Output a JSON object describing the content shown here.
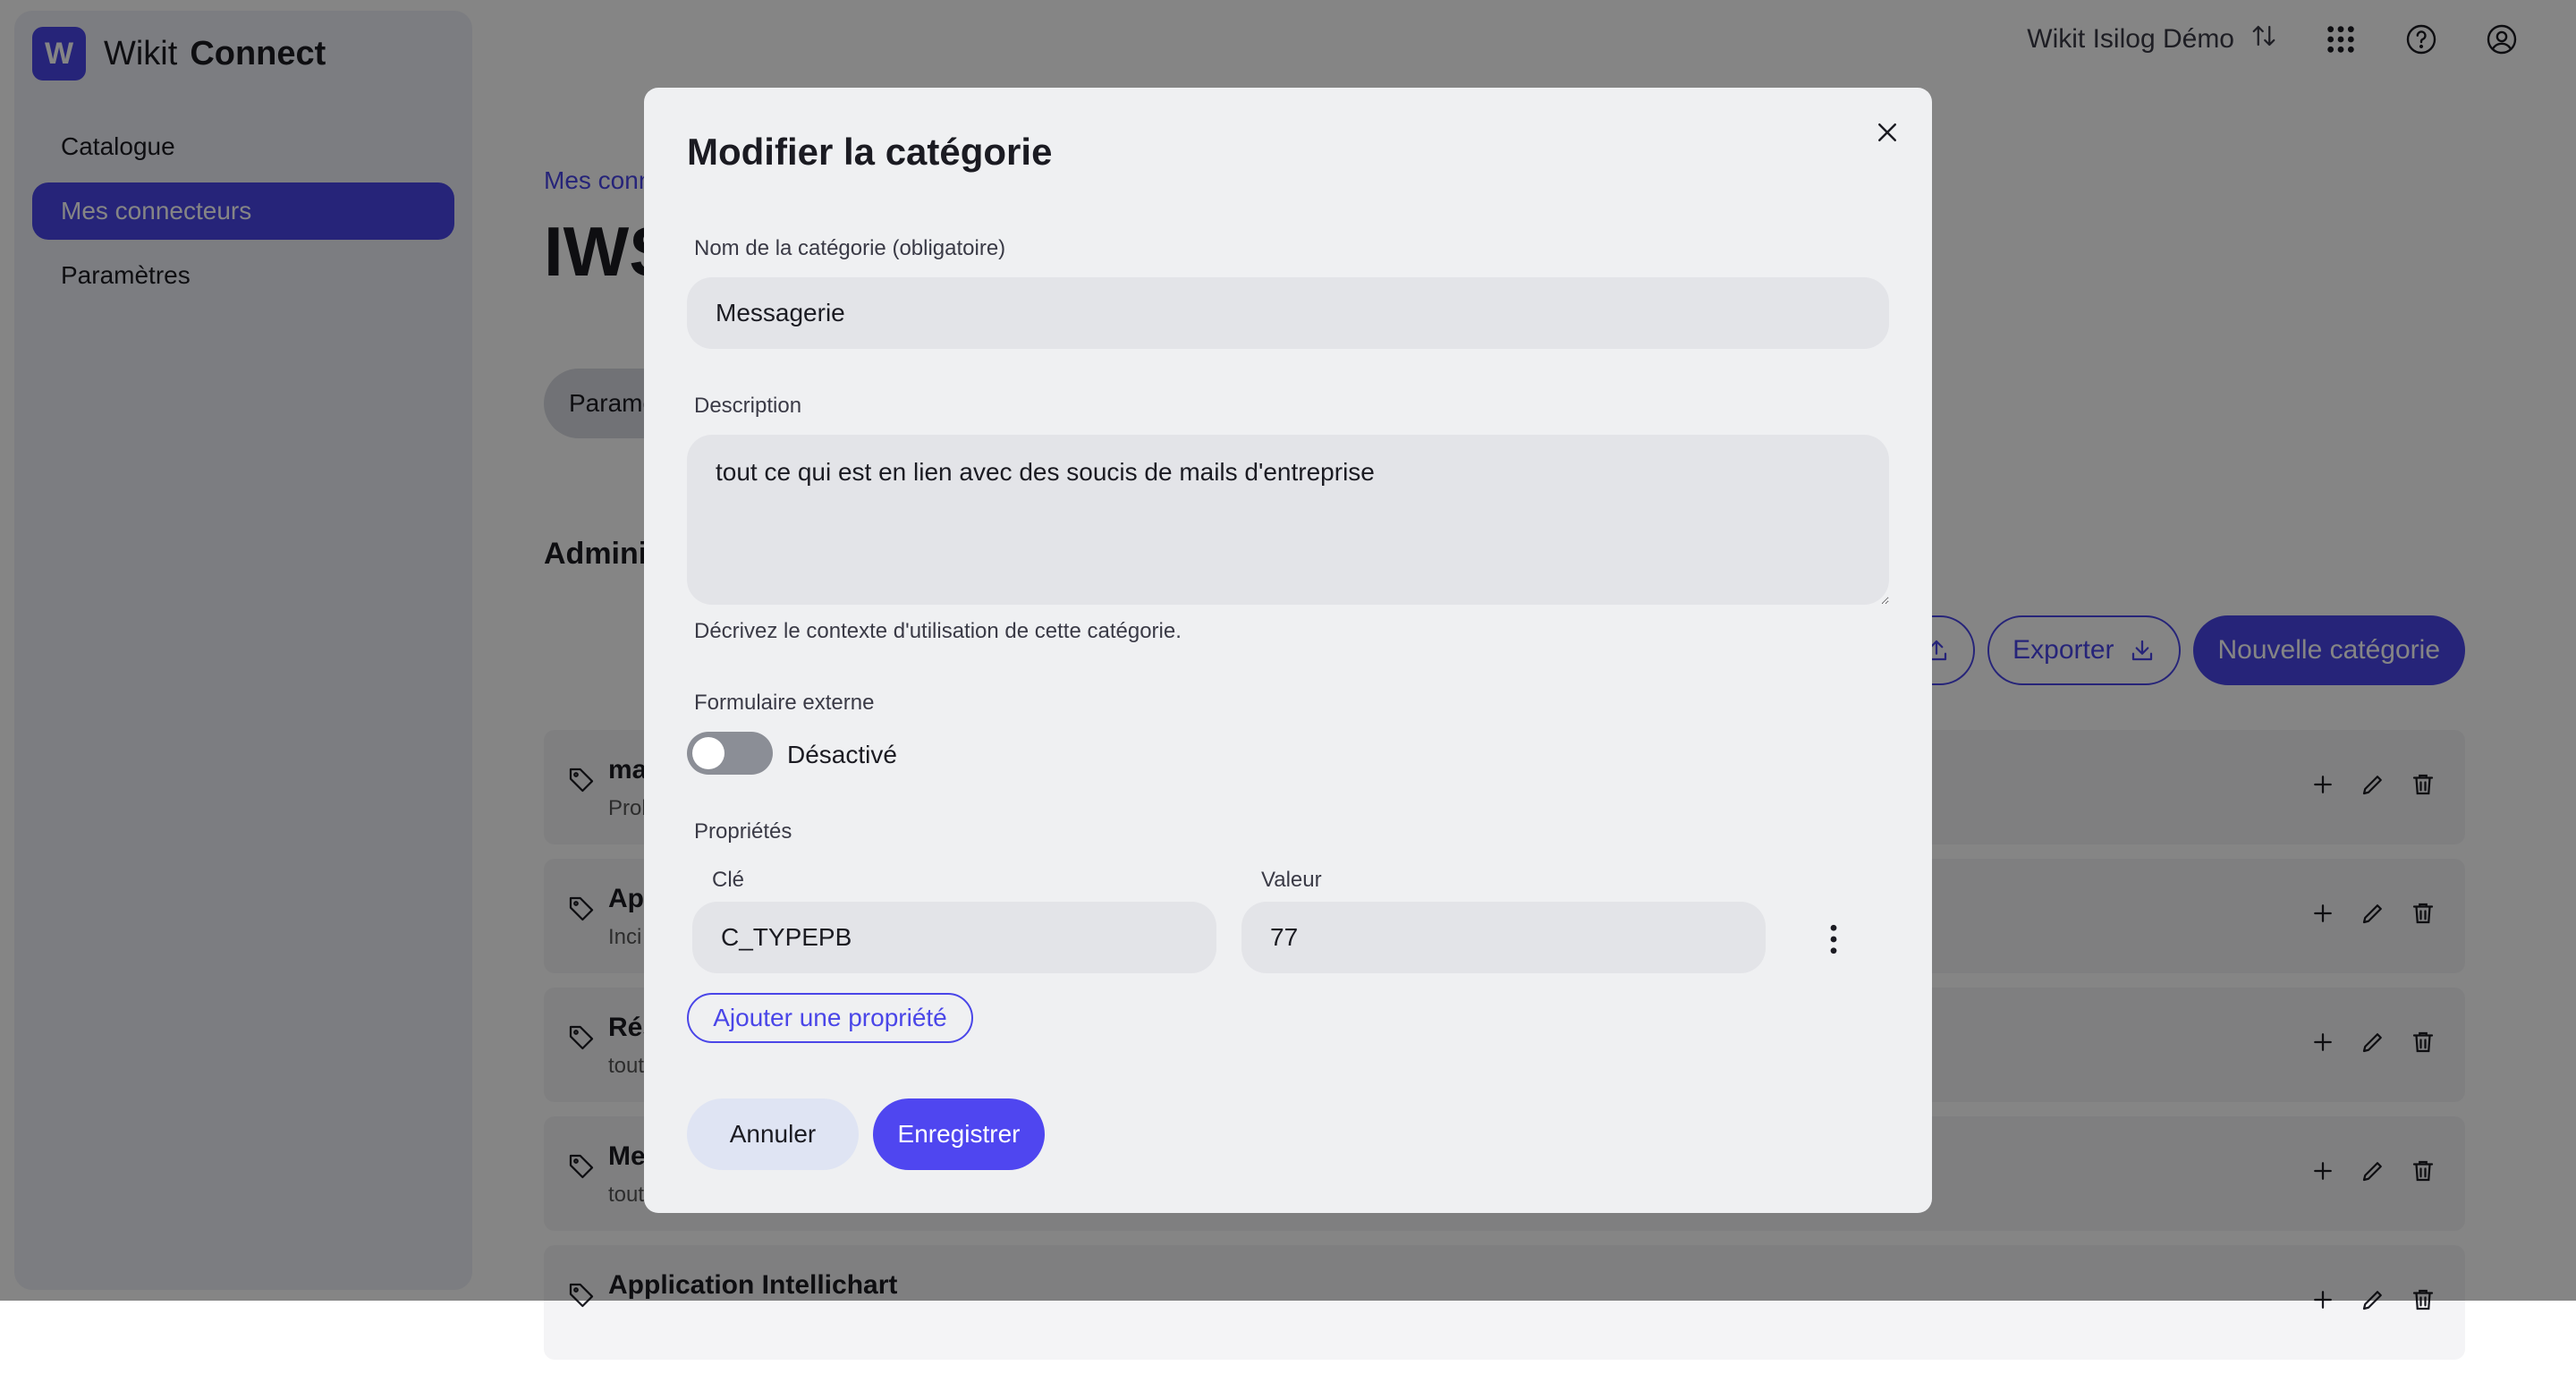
{
  "app": {
    "logo_letter": "W",
    "logo_light": "Wikit",
    "logo_bold": "Connect",
    "tenant": "Wikit Isilog Démo"
  },
  "sidebar": {
    "items": [
      {
        "label": "Catalogue",
        "active": false
      },
      {
        "label": "Mes connecteurs",
        "active": true
      },
      {
        "label": "Paramètres",
        "active": false
      }
    ]
  },
  "main": {
    "breadcrumb": "Mes connecteurs",
    "title": "IWS",
    "tab": "Paramètres",
    "section_title": "Administration",
    "export_label": "Exporter",
    "new_category_label": "Nouvelle catégorie",
    "categories": [
      {
        "name": "ma",
        "desc": "Prob"
      },
      {
        "name": "App",
        "desc": "Inci"
      },
      {
        "name": "Rés",
        "desc": "tout"
      },
      {
        "name": "Me",
        "desc": "tout"
      },
      {
        "name": "Application Intellichart",
        "desc": ""
      }
    ]
  },
  "modal": {
    "title": "Modifier la catégorie",
    "name_label": "Nom de la catégorie (obligatoire)",
    "name_value": "Messagerie",
    "description_label": "Description",
    "description_value": "tout ce qui est en lien avec des soucis de mails d'entreprise",
    "description_hint": "Décrivez le contexte d'utilisation de cette catégorie.",
    "external_form_label": "Formulaire externe",
    "external_form_state": "Désactivé",
    "properties_label": "Propriétés",
    "key_label": "Clé",
    "value_label": "Valeur",
    "key_value": "C_TYPEPB",
    "value_value": "77",
    "add_property_label": "Ajouter une propriété",
    "cancel_label": "Annuler",
    "save_label": "Enregistrer"
  },
  "colors": {
    "accent": "#4a46e8",
    "overlay": "rgba(0,0,0,0.48)"
  }
}
